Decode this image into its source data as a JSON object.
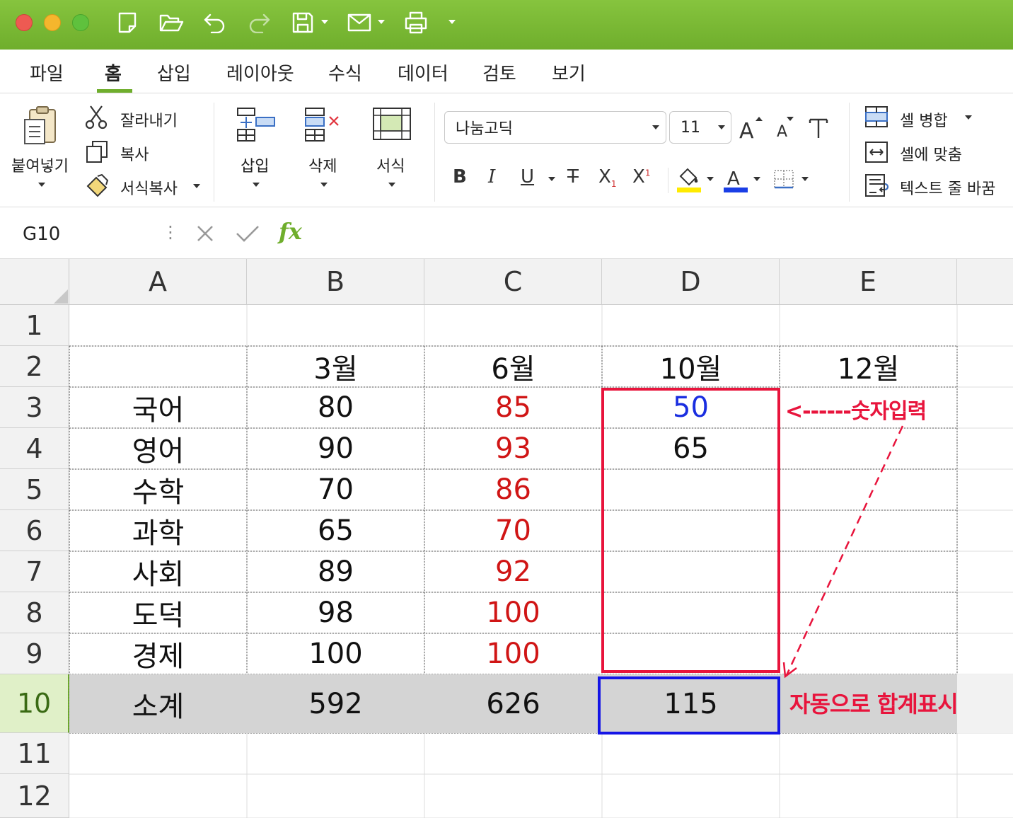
{
  "quick_access": {
    "icons": [
      "new-file-icon",
      "open-folder-icon",
      "undo-icon",
      "redo-icon",
      "save-icon",
      "mail-icon",
      "print-icon"
    ]
  },
  "menu": {
    "tabs": [
      {
        "label": "파일"
      },
      {
        "label": "홈"
      },
      {
        "label": "삽입"
      },
      {
        "label": "레이아웃"
      },
      {
        "label": "수식"
      },
      {
        "label": "데이터"
      },
      {
        "label": "검토"
      },
      {
        "label": "보기"
      }
    ],
    "active_tab": "홈"
  },
  "ribbon": {
    "paste": "붙여넣기",
    "cut": "잘라내기",
    "copy": "복사",
    "format_painter": "서식복사",
    "insert": "삽입",
    "delete": "삭제",
    "format": "서식",
    "font_name": "나눔고딕",
    "font_size": "11",
    "merge_cells": "셀 병합",
    "fit_cell": "셀에 맞춤",
    "wrap_text": "텍스트 줄 바꿈",
    "highlight_color": "#ffeb00",
    "font_color": "#1a3ee6"
  },
  "formula_bar": {
    "cell_ref": "G10",
    "fx": "fx",
    "value": ""
  },
  "sheet": {
    "columns": [
      "A",
      "B",
      "C",
      "D",
      "E"
    ],
    "rows": [
      "1",
      "2",
      "3",
      "4",
      "5",
      "6",
      "7",
      "8",
      "9",
      "10",
      "11",
      "12"
    ],
    "selected_row": "10",
    "cells": {
      "B2": "3월",
      "C2": "6월",
      "D2": "10월",
      "E2": "12월",
      "A3": "국어",
      "B3": "80",
      "C3": "85",
      "D3": "50",
      "A4": "영어",
      "B4": "90",
      "C4": "93",
      "D4": "65",
      "A5": "수학",
      "B5": "70",
      "C5": "86",
      "A6": "과학",
      "B6": "65",
      "C6": "70",
      "A7": "사회",
      "B7": "89",
      "C7": "92",
      "A8": "도덕",
      "B8": "98",
      "C8": "100",
      "A9": "경제",
      "B9": "100",
      "C9": "100",
      "A10": "소계",
      "B10": "592",
      "C10": "626",
      "D10": "115"
    }
  },
  "annotations": {
    "number_input": "<------숫자입력",
    "auto_sum": "자동으로 합계표시",
    "red_color": "#e8143c",
    "blue_color": "#1515e6"
  }
}
